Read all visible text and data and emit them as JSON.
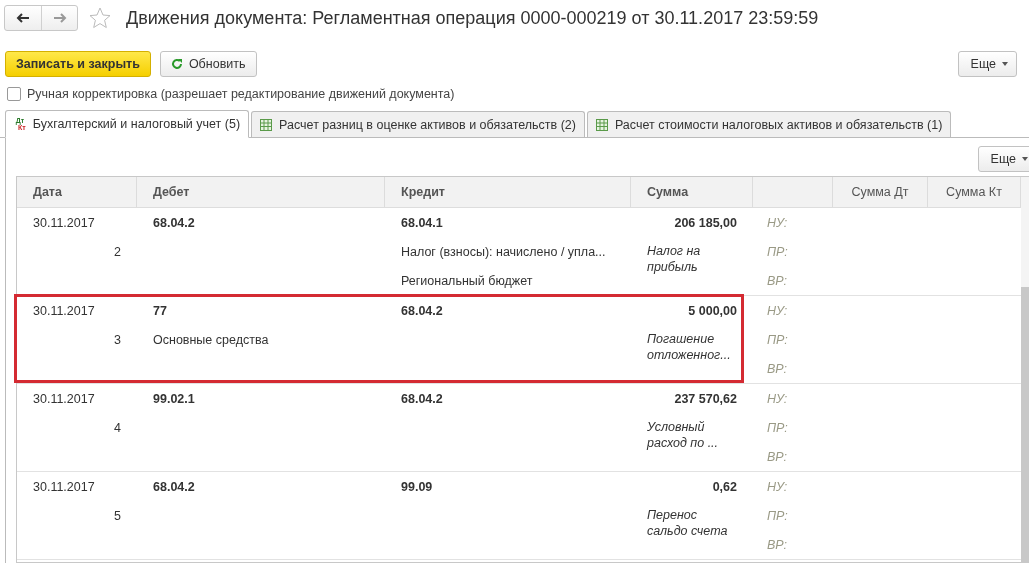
{
  "window": {
    "title": "Движения документа: Регламентная операция 0000-000219 от 30.11.2017 23:59:59",
    "favorite": false
  },
  "toolbar": {
    "buttons": [
      {
        "label": "Записать и закрыть",
        "kind": "primary"
      },
      {
        "label": "Обновить",
        "kind": "refresh"
      }
    ],
    "more": "Еще"
  },
  "manual_edit": {
    "label": "Ручная корректировка (разрешает редактирование движений документа)",
    "checked": false
  },
  "tabs": [
    {
      "label": "Бухгалтерский и налоговый учет (5)",
      "kind": "ledger",
      "icon_top": "Дт",
      "icon_bottom": "Кт",
      "selected": true
    },
    {
      "label": "Расчет разниц в оценке активов и обязательств (2)",
      "kind": "table",
      "selected": false
    },
    {
      "label": "Расчет стоимости налоговых активов и обязательств (1)",
      "kind": "table",
      "selected": false
    }
  ],
  "panel_more": "Еще",
  "table": {
    "columns": [
      {
        "label": "Дата"
      },
      {
        "label": "Дебет"
      },
      {
        "label": "Кредит"
      },
      {
        "label": "Сумма"
      },
      {
        "kind": "blank"
      },
      {
        "label": "Сумма Дт"
      },
      {
        "label": "Сумма Кт"
      }
    ],
    "rows": [
      {
        "date": "30.11.2017",
        "number": "2",
        "debit": [
          "68.04.2"
        ],
        "credit": [
          "68.04.1",
          "Налог (взносы): начислено / упла...",
          "Региональный бюджет"
        ],
        "amount": "206 185,00",
        "content": "Налог на прибыль",
        "labels": [
          "НУ:",
          "ПР:",
          "ВР:"
        ],
        "highlighted": false
      },
      {
        "date": "30.11.2017",
        "number": "3",
        "debit": [
          "77",
          "Основные средства"
        ],
        "credit": [
          "68.04.2"
        ],
        "amount": "5 000,00",
        "content": "Погашение отложенног...",
        "labels": [
          "НУ:",
          "ПР:",
          "ВР:"
        ],
        "highlighted": true
      },
      {
        "date": "30.11.2017",
        "number": "4",
        "debit": [
          "99.02.1"
        ],
        "credit": [
          "68.04.2"
        ],
        "amount": "237 570,62",
        "content": "Условный расход по ...",
        "labels": [
          "НУ:",
          "ПР:",
          "ВР:"
        ],
        "highlighted": false
      },
      {
        "date": "30.11.2017",
        "number": "5",
        "debit": [
          "68.04.2"
        ],
        "credit": [
          "99.09"
        ],
        "amount": "0,62",
        "content": "Перенос сальдо счета",
        "labels": [
          "НУ:",
          "ПР:",
          "ВР:"
        ],
        "highlighted": false
      }
    ]
  }
}
